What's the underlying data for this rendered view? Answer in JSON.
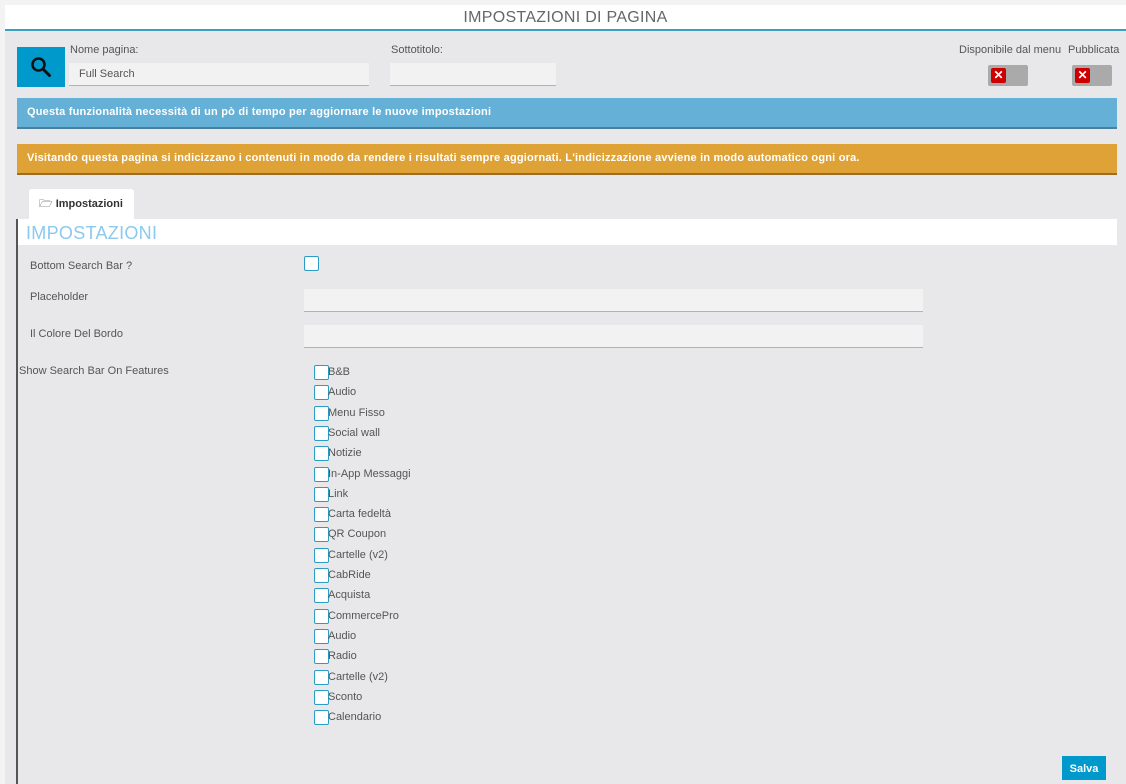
{
  "header": {
    "title": "IMPOSTAZIONI DI PAGINA"
  },
  "page_info": {
    "icon": "search-icon",
    "name_label": "Nome pagina:",
    "name_value": "Full Search",
    "subtitle_label": "Sottotitolo:",
    "subtitle_value": "",
    "menu_available_label": "Disponibile dal menu",
    "menu_available": false,
    "published_label": "Pubblicata",
    "published": false,
    "toggle_off_glyph": "✕"
  },
  "alerts": {
    "info": "Questa funzionalità necessità di un pò di tempo per aggiornare le nuove impostazioni",
    "warning": "Visitando questa pagina si indicizzano i contenuti in modo da rendere i risultati sempre aggiornati. L'indicizzazione avviene in modo automatico ogni ora."
  },
  "tabs": [
    {
      "label": "Impostazioni",
      "icon": "folder-open-icon",
      "glyph": "🗁",
      "active": true
    }
  ],
  "settings": {
    "section_title": "IMPOSTAZIONI",
    "bottom_search_bar_label": "Bottom Search Bar ?",
    "bottom_search_bar_checked": false,
    "placeholder_label": "Placeholder",
    "placeholder_value": "",
    "border_color_label": "Il Colore Del Bordo",
    "border_color_value": "",
    "features_label": "Show Search Bar On Features",
    "features": [
      {
        "label": "B&B",
        "checked": false
      },
      {
        "label": "Audio",
        "checked": false
      },
      {
        "label": "Menu Fisso",
        "checked": false
      },
      {
        "label": "Social wall",
        "checked": false
      },
      {
        "label": "Notizie",
        "checked": false
      },
      {
        "label": "In-App Messaggi",
        "checked": false
      },
      {
        "label": "Link",
        "checked": false
      },
      {
        "label": "Carta fedeltà",
        "checked": false
      },
      {
        "label": "QR Coupon",
        "checked": false
      },
      {
        "label": "Cartelle (v2)",
        "checked": false
      },
      {
        "label": "CabRide",
        "checked": false
      },
      {
        "label": "Acquista",
        "checked": false
      },
      {
        "label": "CommercePro",
        "checked": false
      },
      {
        "label": "Audio",
        "checked": false
      },
      {
        "label": "Radio",
        "checked": false
      },
      {
        "label": "Cartelle (v2)",
        "checked": false
      },
      {
        "label": "Sconto",
        "checked": false
      },
      {
        "label": "Calendario",
        "checked": false
      }
    ]
  },
  "actions": {
    "save_label": "Salva"
  },
  "colors": {
    "accent": "#0099cc",
    "info": "#65b0d6",
    "warning": "#dfa236",
    "toggle_off": "#cc0000",
    "section_title": "#8bc9ef"
  }
}
